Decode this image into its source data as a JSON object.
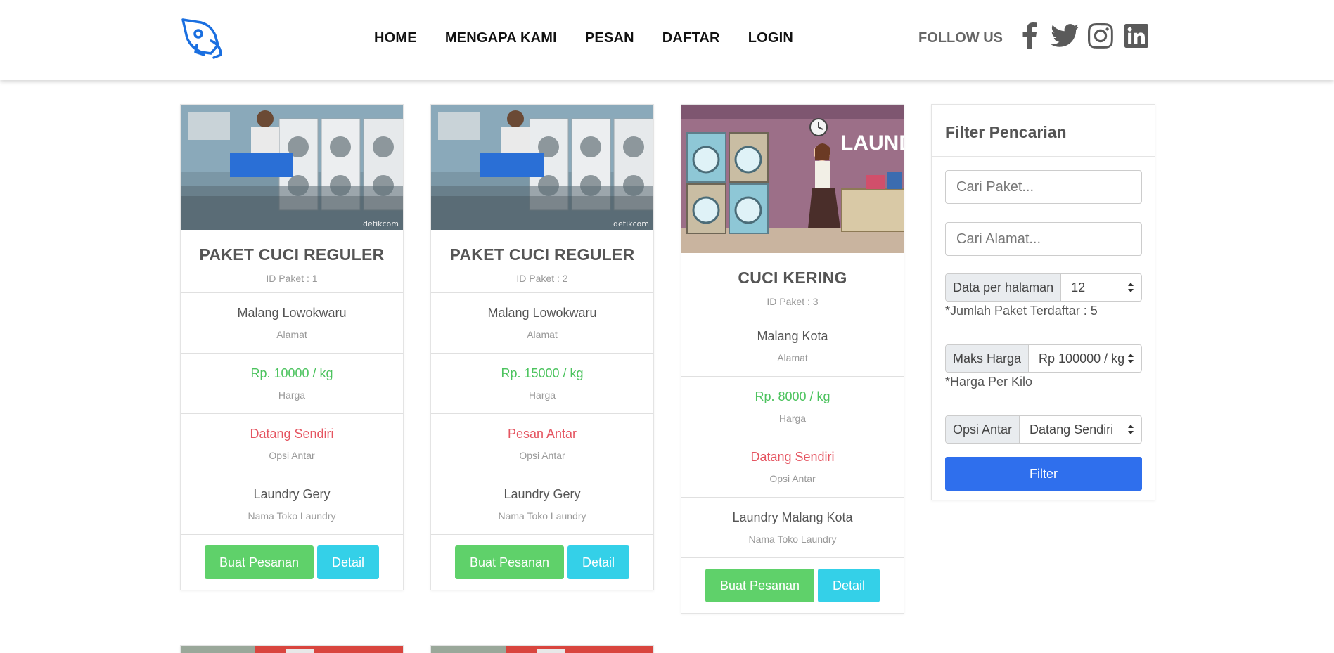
{
  "nav": {
    "links": [
      "HOME",
      "MENGAPA KAMI",
      "PESAN",
      "DAFTAR",
      "LOGIN"
    ],
    "follow_label": "FOLLOW US",
    "social": [
      "facebook-icon",
      "twitter-icon",
      "instagram-icon",
      "linkedin-icon"
    ]
  },
  "cards": [
    {
      "title": "PAKET CUCI REGULER",
      "id_label": "ID Paket : 1",
      "address": "Malang Lowokwaru",
      "address_label": "Alamat",
      "price": "Rp. 10000 / kg",
      "price_label": "Harga",
      "delivery": "Datang Sendiri",
      "delivery_label": "Opsi Antar",
      "shop": "Laundry Gery",
      "shop_label": "Nama Toko Laundry",
      "order_btn": "Buat Pesanan",
      "detail_btn": "Detail",
      "watermark": "detikcom"
    },
    {
      "title": "PAKET CUCI REGULER",
      "id_label": "ID Paket : 2",
      "address": "Malang Lowokwaru",
      "address_label": "Alamat",
      "price": "Rp. 15000 / kg",
      "price_label": "Harga",
      "delivery": "Pesan Antar",
      "delivery_label": "Opsi Antar",
      "shop": "Laundry Gery",
      "shop_label": "Nama Toko Laundry",
      "order_btn": "Buat Pesanan",
      "detail_btn": "Detail",
      "watermark": "detikcom"
    },
    {
      "title": "CUCI KERING",
      "id_label": "ID Paket : 3",
      "address": "Malang Kota",
      "address_label": "Alamat",
      "price": "Rp. 8000 / kg",
      "price_label": "Harga",
      "delivery": "Datang Sendiri",
      "delivery_label": "Opsi Antar",
      "shop": "Laundry Malang Kota",
      "shop_label": "Nama Toko Laundry",
      "order_btn": "Buat Pesanan",
      "detail_btn": "Detail",
      "sign_text": "LAUNDRY"
    }
  ],
  "filter": {
    "title": "Filter Pencarian",
    "search_paket_placeholder": "Cari Paket...",
    "search_alamat_placeholder": "Cari Alamat...",
    "per_page_label": "Data per halaman",
    "per_page_value": "12",
    "count_note": "*Jumlah Paket Terdaftar : 5",
    "max_price_label": "Maks Harga",
    "max_price_value": "Rp 100000 / kg",
    "price_note": "*Harga Per Kilo",
    "delivery_label": "Opsi Antar",
    "delivery_value": "Datang Sendiri",
    "filter_btn": "Filter"
  },
  "colors": {
    "accent_blue": "#2f6fed",
    "logo_blue": "#1a6fe0",
    "order_green": "#5fd16a",
    "detail_cyan": "#34d0e8",
    "price_green": "#4cc35e",
    "delivery_red": "#e55561"
  }
}
